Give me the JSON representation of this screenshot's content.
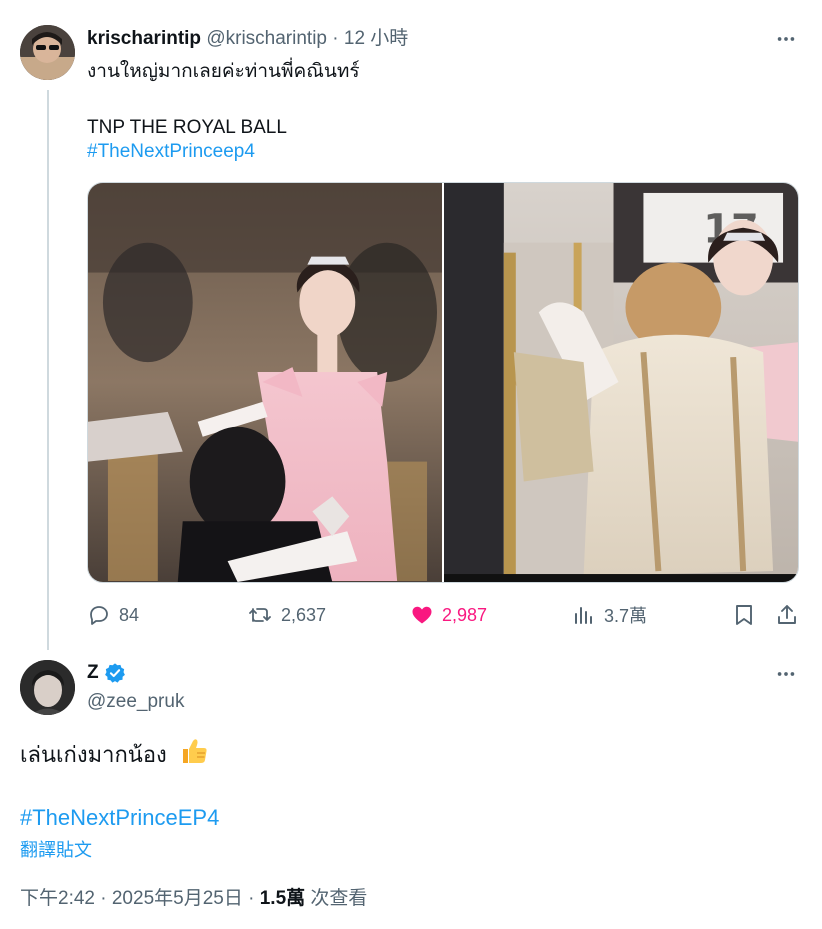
{
  "parent_tweet": {
    "display_name": "krischarintip",
    "handle": "@krischarintip",
    "separator": "·",
    "time": "12 小時",
    "text_line1": "งานใหญ่มากเลยค่ะท่านพี่คณินทร์",
    "text_line2": "TNP THE ROYAL BALL",
    "hashtag": "#TheNextPrinceep4",
    "media_count": 2,
    "stats": {
      "replies": "84",
      "retweets": "2,637",
      "likes": "2,987",
      "views": "3.7萬"
    },
    "liked": true
  },
  "reply_tweet": {
    "display_name": "Z",
    "verified": true,
    "handle": "@zee_pruk",
    "text": "เล่นเก่งมากน้อง",
    "emoji": "👍",
    "hashtag": "#TheNextPrinceEP4",
    "translate_label": "翻譯貼文",
    "timestamp": "下午2:42 · 2025年5月25日 · ",
    "views_count": "1.5萬",
    "views_label": " 次查看"
  },
  "colors": {
    "accent": "#1d9bf0",
    "like": "#f91880",
    "muted": "#536471",
    "text": "#0f1419",
    "thread_line": "#cfd9de"
  },
  "icons": {
    "reply": "comment-icon",
    "retweet": "retweet-icon",
    "like": "heart-filled-icon",
    "views": "analytics-icon",
    "bookmark": "bookmark-icon",
    "share": "share-icon",
    "more": "more-horizontal-icon",
    "verified": "verified-badge-icon"
  }
}
